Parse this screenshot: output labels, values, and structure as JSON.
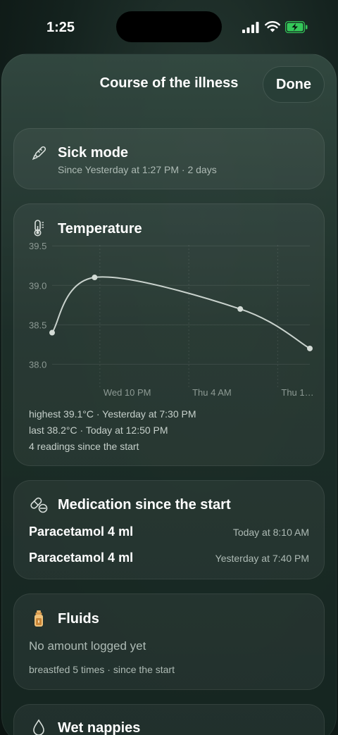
{
  "status_bar": {
    "time": "1:25"
  },
  "header": {
    "title": "Course of the illness",
    "done_label": "Done"
  },
  "sick_mode": {
    "icon": "thermometer-pencil-icon",
    "title": "Sick mode",
    "subtitle": "Since Yesterday at 1:27 PM · 2 days"
  },
  "temperature": {
    "icon": "thermometer-icon",
    "title": "Temperature",
    "highest": "highest 39.1°C · Yesterday at 7:30 PM",
    "last": "last 38.2°C · Today at 12:50 PM",
    "readings": "4 readings since the start"
  },
  "chart_data": {
    "type": "line",
    "title": "",
    "xlabel": "",
    "ylabel": "",
    "ylim": [
      37.7,
      39.6
    ],
    "yticks": [
      39.5,
      39.0,
      38.5,
      38.0
    ],
    "ytick_labels": [
      "39.5",
      "39.0",
      "38.5",
      "38.0"
    ],
    "xticks": [
      {
        "label": "Wed 10 PM",
        "position": 0.24
      },
      {
        "label": "Thu 4 AM",
        "position": 0.585
      },
      {
        "label": "Thu 1…",
        "position": 0.93
      }
    ],
    "x_domain": [
      0,
      1
    ],
    "series": [
      {
        "x": [
          0,
          0.165,
          0.73,
          1
        ],
        "values": [
          38.4,
          39.1,
          38.7,
          38.2
        ]
      }
    ],
    "grid": true,
    "line_color": "#c9d2cd",
    "point_color": "#d3dbd6"
  },
  "medication": {
    "icon": "pills-icon",
    "title": "Medication since the start",
    "items": [
      {
        "name": "Paracetamol 4 ml",
        "time": "Today at 8:10 AM"
      },
      {
        "name": "Paracetamol 4 ml",
        "time": "Yesterday at 7:40 PM"
      }
    ]
  },
  "fluids": {
    "icon": "bottle-icon",
    "title": "Fluids",
    "empty": "No amount logged yet",
    "footer": "breastfed 5 times · since the start"
  },
  "wet_nappies": {
    "icon": "drop-icon",
    "title": "Wet nappies"
  }
}
